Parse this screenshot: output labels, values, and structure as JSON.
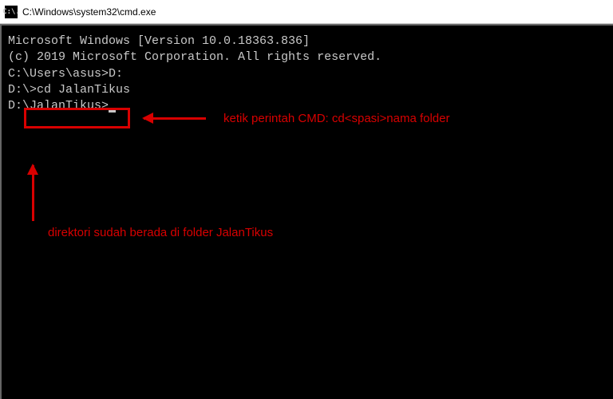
{
  "titlebar": {
    "icon_text": "C:\\.",
    "title": "C:\\Windows\\system32\\cmd.exe"
  },
  "terminal": {
    "line1": "Microsoft Windows [Version 10.0.18363.836]",
    "line2": "(c) 2019 Microsoft Corporation. All rights reserved.",
    "blank1": "",
    "prompt1": "C:\\Users\\asus>",
    "cmd1": "D:",
    "blank2": "",
    "prompt2": "D:\\>",
    "cmd2": "cd JalanTikus",
    "blank3": "",
    "prompt3": "D:\\JalanTikus>"
  },
  "annotations": {
    "top": "ketik perintah CMD: cd<spasi>nama folder",
    "bottom": "direktori sudah berada di folder JalanTikus"
  }
}
